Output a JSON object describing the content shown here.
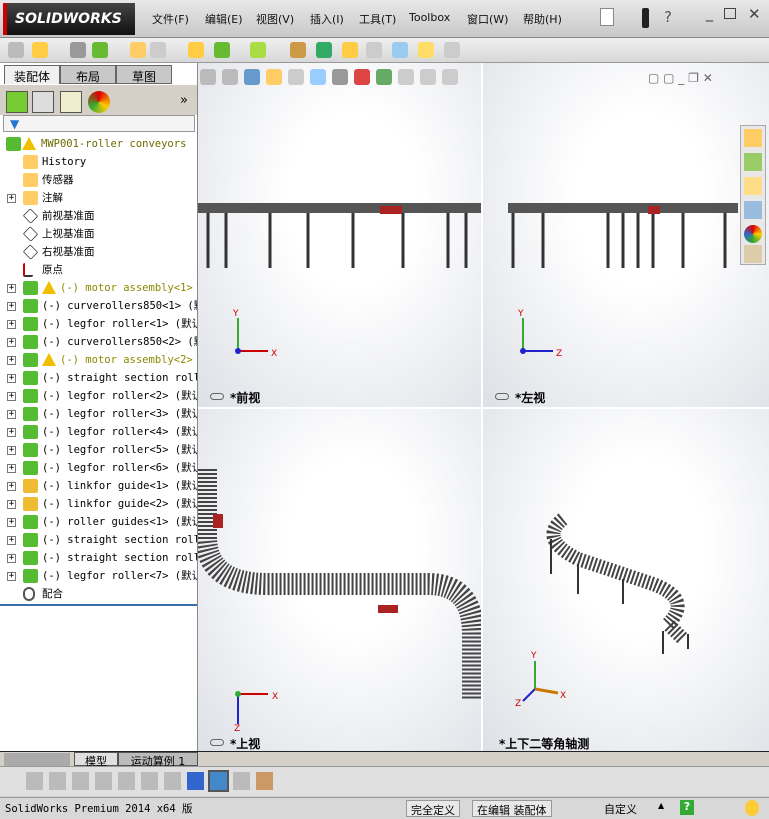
{
  "app": {
    "logo": "SOLIDWORKS"
  },
  "menu": [
    "文件(F)",
    "编辑(E)",
    "视图(V)",
    "插入(I)",
    "工具(T)",
    "Toolbox",
    "窗口(W)",
    "帮助(H)"
  ],
  "left_tabs": [
    "装配体",
    "布局",
    "草图"
  ],
  "panel_more": "»",
  "tree": [
    {
      "label": "MWP001-roller conveyors",
      "icon": "assembly-icon",
      "warn": true,
      "expand": false,
      "color": "#6b6b00"
    },
    {
      "label": "History",
      "icon": "history-icon",
      "expand": false
    },
    {
      "label": "传感器",
      "icon": "sensor-icon",
      "expand": false
    },
    {
      "label": "注解",
      "icon": "annotation-icon",
      "expand": true
    },
    {
      "label": "前视基准面",
      "icon": "plane-icon",
      "expand": false
    },
    {
      "label": "上视基准面",
      "icon": "plane-icon",
      "expand": false
    },
    {
      "label": "右视基准面",
      "icon": "plane-icon",
      "expand": false
    },
    {
      "label": "原点",
      "icon": "origin-icon",
      "expand": false
    },
    {
      "label": "(-) motor assembly<1>",
      "icon": "assembly-icon",
      "warn": true,
      "expand": true,
      "color": "#8a8a00"
    },
    {
      "label": "(-) curverollers850<1> (默",
      "icon": "assembly-icon",
      "expand": true
    },
    {
      "label": "(-) legfor roller<1> (默认",
      "icon": "assembly-icon",
      "expand": true
    },
    {
      "label": "(-) curverollers850<2> (默",
      "icon": "assembly-icon",
      "expand": true
    },
    {
      "label": "(-) motor assembly<2>",
      "icon": "assembly-icon",
      "warn": true,
      "expand": true,
      "color": "#8a8a00"
    },
    {
      "label": "(-) straight section rolle",
      "icon": "assembly-icon",
      "expand": true
    },
    {
      "label": "(-) legfor roller<2> (默认",
      "icon": "assembly-icon",
      "expand": true
    },
    {
      "label": "(-) legfor roller<3> (默认",
      "icon": "assembly-icon",
      "expand": true
    },
    {
      "label": "(-) legfor roller<4> (默认",
      "icon": "assembly-icon",
      "expand": true
    },
    {
      "label": "(-) legfor roller<5> (默认",
      "icon": "assembly-icon",
      "expand": true
    },
    {
      "label": "(-) legfor roller<6> (默认",
      "icon": "assembly-icon",
      "expand": true
    },
    {
      "label": "(-) linkfor guide<1> (默认",
      "icon": "part-icon",
      "expand": true
    },
    {
      "label": "(-) linkfor guide<2> (默认",
      "icon": "part-icon",
      "expand": true
    },
    {
      "label": "(-) roller guides<1> (默认",
      "icon": "assembly-icon",
      "expand": true
    },
    {
      "label": "(-) straight section rolle",
      "icon": "assembly-icon",
      "expand": true
    },
    {
      "label": "(-) straight section rolle",
      "icon": "assembly-icon",
      "expand": true
    },
    {
      "label": "(-) legfor roller<7> (默认",
      "icon": "assembly-icon",
      "expand": true
    },
    {
      "label": "配合",
      "icon": "mates-icon",
      "expand": false
    }
  ],
  "viewports": [
    {
      "label": "*前视",
      "axes": [
        "Y",
        "X"
      ]
    },
    {
      "label": "*左视",
      "axes": [
        "Y",
        "Z"
      ]
    },
    {
      "label": "*上视",
      "axes": [
        "X",
        "Z"
      ]
    },
    {
      "label": "*上下二等角轴测",
      "axes": [
        "Y",
        "X",
        "Z"
      ]
    }
  ],
  "bottom_tabs": [
    "模型",
    "运动算例 1"
  ],
  "status": {
    "product": "SolidWorks Premium 2014 x64 版",
    "defined": "完全定义",
    "editing": "在编辑 装配体",
    "units": "自定义"
  }
}
